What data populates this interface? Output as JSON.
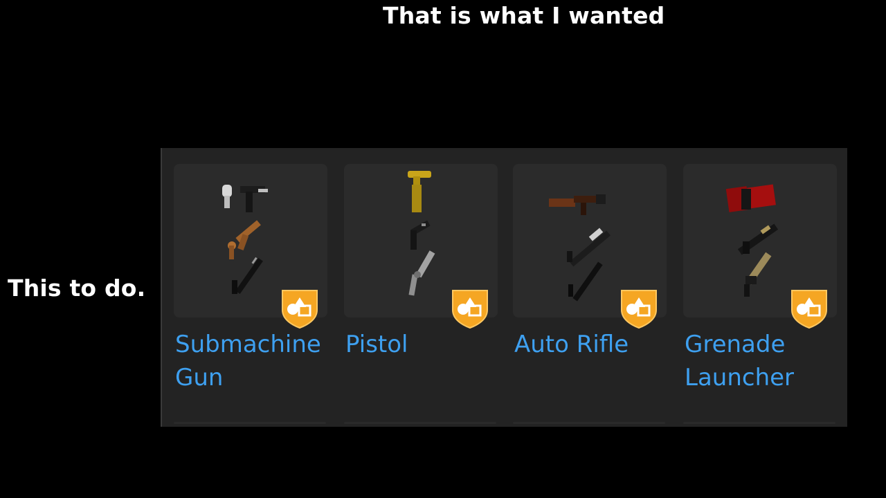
{
  "captions": {
    "top": "That is what I wanted",
    "left": "This to do."
  },
  "catalog": {
    "items": [
      {
        "label": "Submachine Gun",
        "badge_icon": "shapes-badge-icon",
        "weapon_icons": [
          "silver-pistol-icon",
          "bronze-pistol-icon",
          "black-smg-icon"
        ]
      },
      {
        "label": "Pistol",
        "badge_icon": "shapes-badge-icon",
        "weapon_icons": [
          "gold-pistol-icon",
          "black-pistol-icon",
          "silver-revolver-icon"
        ]
      },
      {
        "label": "Auto Rifle",
        "badge_icon": "shapes-badge-icon",
        "weapon_icons": [
          "wooden-rifle-icon",
          "silver-rifle-icon",
          "black-rifle-icon"
        ]
      },
      {
        "label": "Grenade Launcher",
        "badge_icon": "shapes-badge-icon",
        "weapon_icons": [
          "red-launcher-icon",
          "black-launcher-icon",
          "tan-launcher-icon"
        ]
      }
    ]
  },
  "colors": {
    "background": "#000000",
    "panel": "#232323",
    "card": "#2b2b2b",
    "label": "#3ea0f0",
    "badge": "#f5a623"
  }
}
